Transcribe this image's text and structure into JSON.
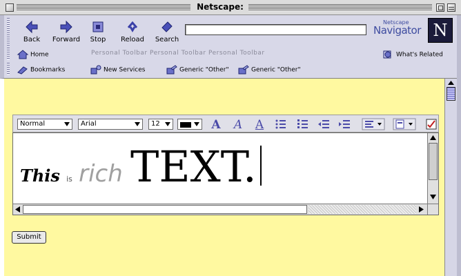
{
  "window": {
    "title": "Netscape:"
  },
  "nav": {
    "back": "Back",
    "forward": "Forward",
    "stop": "Stop",
    "reload": "Reload",
    "search": "Search"
  },
  "location": {
    "value": ""
  },
  "brand": {
    "small": "Netscape",
    "big": "Navigator",
    "logo_letter": "N"
  },
  "personal_toolbar": {
    "home": "Home",
    "items": [
      "Personal Toolbar",
      "Personal Toolbar",
      "Personal Toolbar"
    ],
    "whats_related": "What's Related"
  },
  "bookmarks_bar": {
    "bookmarks": "Bookmarks",
    "new_services": "New Services",
    "generic1": "Generic \"Other\"",
    "generic2": "Generic \"Other\""
  },
  "editor_toolbar": {
    "paragraph_style": "Normal",
    "font": "Arial",
    "size": "12",
    "color": "#000000"
  },
  "editor": {
    "words": [
      "This",
      "is",
      "rich",
      "TEXT."
    ]
  },
  "form": {
    "submit": "Submit"
  },
  "colors": {
    "page_bg": "#fff9a0",
    "chrome_bg": "#d8d8e8",
    "accent": "#3e4ca0"
  }
}
